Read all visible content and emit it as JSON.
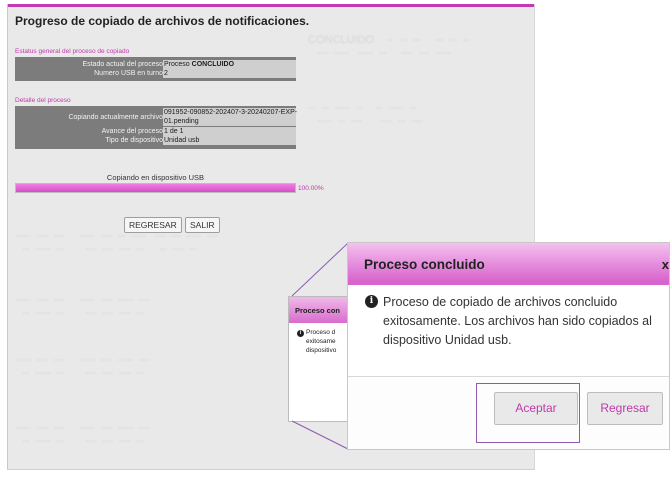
{
  "page": {
    "title": "Progreso de copiado de archivos de notificaciones.",
    "general_section": {
      "label": "Estatus general del proceso de copiado",
      "rows": [
        {
          "key": "Estado actual del proceso",
          "prefix": "Proceso",
          "value": "CONCLUIDO"
        },
        {
          "key": "Numero USB en turno",
          "value": "2"
        }
      ]
    },
    "detail_section": {
      "label": "Detalle del proceso",
      "rows": [
        {
          "key": "Copiando actualmente archivo",
          "value_line1": "091952-090852-202407-3-20240207-EXP-",
          "value_line2": "01.pending"
        },
        {
          "key": "Avance del proceso",
          "value": "1 de 1"
        },
        {
          "key": "Tipo de dispositivo",
          "value": "Unidad usb"
        }
      ]
    },
    "progress": {
      "label": "Copiando en dispositivo USB",
      "percent_text": "100.00%",
      "fraction": 1.0
    },
    "buttons": {
      "regresar": "REGRESAR",
      "salir": "SALIR"
    }
  },
  "mini_dialog": {
    "title": "Proceso con",
    "lines": [
      "Proceso d",
      "exitosame",
      "dispositivo"
    ]
  },
  "dialog": {
    "title": "Proceso concluido",
    "close": "x",
    "message": "Proceso de copiado de archivos concluido exitosamente. Los archivos han sido copiados al dispositivo Unidad usb.",
    "accept": "Aceptar",
    "back": "Regresar"
  },
  "colors": {
    "accent": "#c03aa8",
    "header_pink": "#d865cd",
    "panel_gray": "#7c7c7c"
  },
  "icons": {
    "info": "info-circle-icon"
  }
}
